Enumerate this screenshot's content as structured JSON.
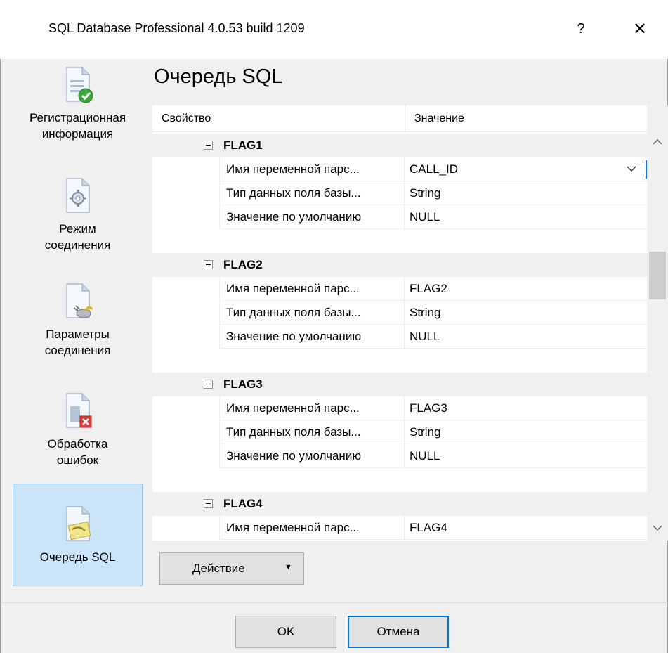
{
  "window": {
    "title": "SQL Database Professional 4.0.53 build 1209",
    "help_label": "?",
    "close_label": "✕"
  },
  "nav": {
    "items": [
      {
        "label_line1": "Регистрационная",
        "label_line2": "информация",
        "icon": "document-check-icon"
      },
      {
        "label_line1": "Режим",
        "label_line2": "соединения",
        "icon": "document-gear-icon"
      },
      {
        "label_line1": "Параметры",
        "label_line2": "соединения",
        "icon": "document-plug-icon"
      },
      {
        "label_line1": "Обработка",
        "label_line2": "ошибок",
        "icon": "document-error-icon"
      },
      {
        "label_line1": "Очередь SQL",
        "label_line2": "",
        "icon": "document-queue-icon",
        "active": true
      }
    ]
  },
  "page": {
    "title": "Очередь SQL"
  },
  "grid": {
    "col_property": "Свойство",
    "col_value": "Значение",
    "groups": [
      {
        "name": "FLAG1",
        "rows": [
          {
            "property": "Имя переменной парс...",
            "value": "CALL_ID"
          },
          {
            "property": "Тип данных поля базы...",
            "value": "String"
          },
          {
            "property": "Значение по умолчанию",
            "value": "NULL"
          }
        ]
      },
      {
        "name": "FLAG2",
        "rows": [
          {
            "property": "Имя переменной парс...",
            "value": "FLAG2"
          },
          {
            "property": "Тип данных поля базы...",
            "value": "String"
          },
          {
            "property": "Значение по умолчанию",
            "value": "NULL"
          }
        ]
      },
      {
        "name": "FLAG3",
        "rows": [
          {
            "property": "Имя переменной парс...",
            "value": "FLAG3"
          },
          {
            "property": "Тип данных поля базы...",
            "value": "String"
          },
          {
            "property": "Значение по умолчанию",
            "value": "NULL"
          }
        ]
      },
      {
        "name": "FLAG4",
        "rows": [
          {
            "property": "Имя переменной парс...",
            "value": "FLAG4"
          }
        ]
      }
    ]
  },
  "action": {
    "label": "Действие",
    "arrow": "▼"
  },
  "footer": {
    "ok_label": "OK",
    "cancel_label": "Отмена"
  }
}
